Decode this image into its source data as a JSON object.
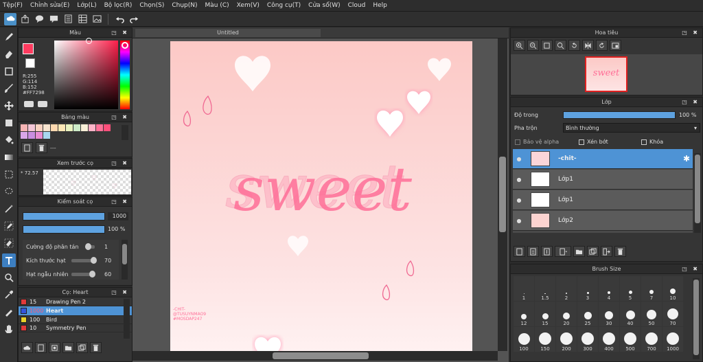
{
  "menu": [
    "Tệp(F)",
    "Chỉnh sửa(E)",
    "Lớp(L)",
    "Bộ lọc(R)",
    "Chọn(S)",
    "Chụp(N)",
    "Màu (C)",
    "Xem(V)",
    "Công cụ(T)",
    "Cửa sổ(W)",
    "Cloud",
    "Help"
  ],
  "canvas": {
    "tab_title": "Untitled",
    "sweet_text": "sweet",
    "signature": "-CHIT-\n@TUSUYNMAO9\n#MOSDAP247"
  },
  "color_panel": {
    "title": "Màu",
    "r": "R:255",
    "g": "G:114",
    "b": "B:152",
    "hex": "#FF7298",
    "current_color": "#ff3b5f"
  },
  "palette_panel": {
    "title": "Bảng màu",
    "name": "---"
  },
  "preview_panel": {
    "title": "Xem trước cọ",
    "value": "72.57"
  },
  "brush_control": {
    "title": "Kiểm soát cọ",
    "size_value": "1000",
    "opacity_value": "100 %",
    "scatter_label": "Cường độ phân tán",
    "scatter_value": "1",
    "grain_label": "Kích thước hạt",
    "grain_value": "70",
    "random_label": "Hạt ngẫu nhiên",
    "random_value": "60"
  },
  "brush_list": {
    "title": "Cọ: Heart",
    "items": [
      {
        "size": "15",
        "name": "Drawing Pen 2",
        "color": "#e23a3a"
      },
      {
        "size": "1000",
        "name": "Heart",
        "color": "#3355dd"
      },
      {
        "size": "100",
        "name": "Bird",
        "color": "#e8d22a"
      },
      {
        "size": "10",
        "name": "Symmetry Pen",
        "color": "#e23a3a"
      }
    ]
  },
  "navigator": {
    "title": "Hoa tiêu"
  },
  "layer_panel": {
    "title": "Lớp",
    "opacity_label": "Độ trong",
    "opacity_value": "100 %",
    "blend_label": "Pha trộn",
    "blend_value": "Bình thường",
    "protect_alpha": "Bảo vệ alpha",
    "clip": "Xén bớt",
    "lock": "Khóa",
    "layers": [
      {
        "name": "-chit-"
      },
      {
        "name": "Lớp1"
      },
      {
        "name": "Lớp1"
      },
      {
        "name": "Lớp2"
      }
    ]
  },
  "brush_size_panel": {
    "title": "Brush Size",
    "sizes": [
      "1",
      "1.5",
      "2",
      "3",
      "4",
      "5",
      "7",
      "10",
      "12",
      "15",
      "20",
      "25",
      "30",
      "40",
      "50",
      "70",
      "100",
      "150",
      "200",
      "300",
      "400",
      "500",
      "700",
      "1000"
    ]
  },
  "icons": [
    "pen-tool-icon",
    "eraser-icon",
    "rectangle-icon",
    "brush-icon",
    "move-icon",
    "fill-rect-icon",
    "bucket-icon",
    "gradient-icon",
    "select-rect-icon",
    "lasso-icon",
    "magic-wand-icon",
    "select-pen-icon",
    "select-eraser-icon",
    "text-icon",
    "zoom-select-icon",
    "eyedropper-icon",
    "hand-icon",
    "undo-icon",
    "redo-icon",
    "cloud-icon"
  ]
}
